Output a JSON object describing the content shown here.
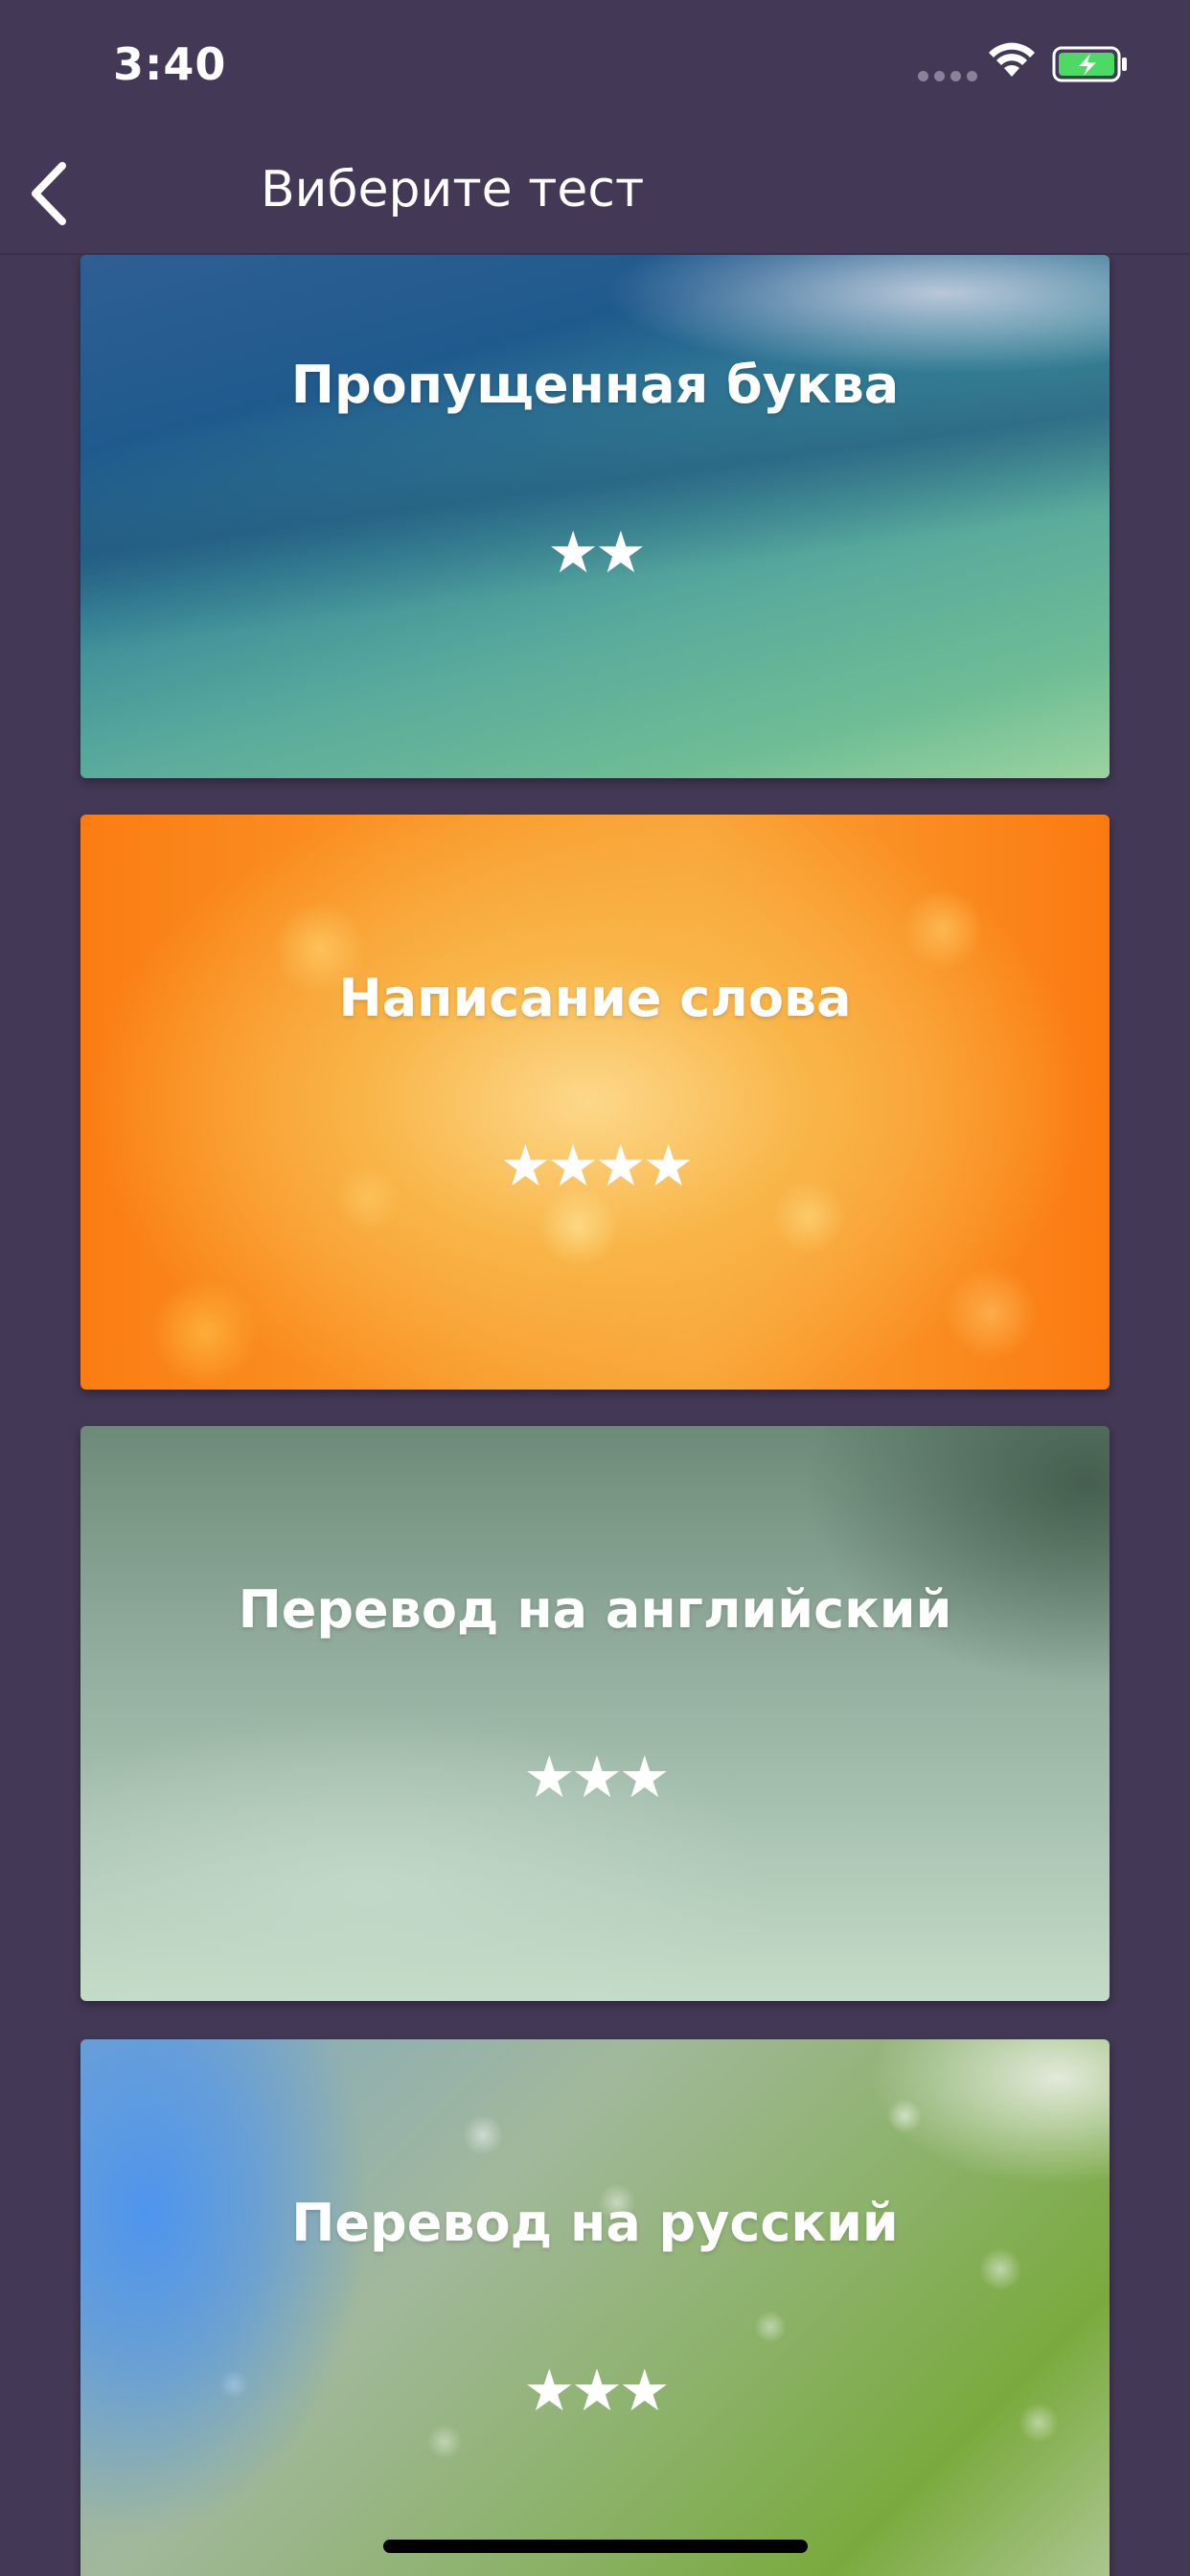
{
  "status_bar": {
    "time": "3:40"
  },
  "nav": {
    "title": "Виберите тест",
    "back_icon": "chevron-left-icon"
  },
  "cards": [
    {
      "title": "Пропущенная буква",
      "stars": "★★",
      "rating": 2
    },
    {
      "title": "Написание слова",
      "stars": "★★★★",
      "rating": 4
    },
    {
      "title": "Перевод на английский",
      "stars": "★★★",
      "rating": 3
    },
    {
      "title": "Перевод на русский",
      "stars": "★★★",
      "rating": 3
    }
  ],
  "colors": {
    "background": "#433856",
    "text": "#ffffff",
    "battery_fill": "#4cd964"
  }
}
